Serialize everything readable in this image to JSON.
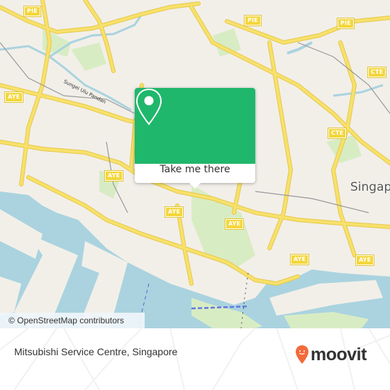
{
  "map": {
    "city_label": "Singap",
    "river_label": "Sungei Ulu Pandan",
    "highway_shields": [
      {
        "label": "PIE"
      },
      {
        "label": "PIE"
      },
      {
        "label": "PIE"
      },
      {
        "label": "CTE"
      },
      {
        "label": "CTE"
      },
      {
        "label": "AYE"
      },
      {
        "label": "AYE"
      },
      {
        "label": "AYE"
      },
      {
        "label": "AYE"
      },
      {
        "label": "AYE"
      },
      {
        "label": "AYE"
      },
      {
        "label": "AYE"
      }
    ],
    "attribution": "© OpenStreetMap contributors",
    "colors": {
      "land": "#f2efe9",
      "water": "#aad3df",
      "park": "#d8ecc4",
      "road": "#f7e16b",
      "road_edge": "#e6c84a",
      "rail": "#999999"
    }
  },
  "popup": {
    "button_label": "Take me there",
    "icon": "map-pin-icon",
    "color": "#1fb76b"
  },
  "footer": {
    "place_name": "Mitsubishi Service Centre, Singapore",
    "logo_text": "moovit",
    "logo_icon": "moovit-pin-icon",
    "logo_color": "#f26b3a"
  }
}
